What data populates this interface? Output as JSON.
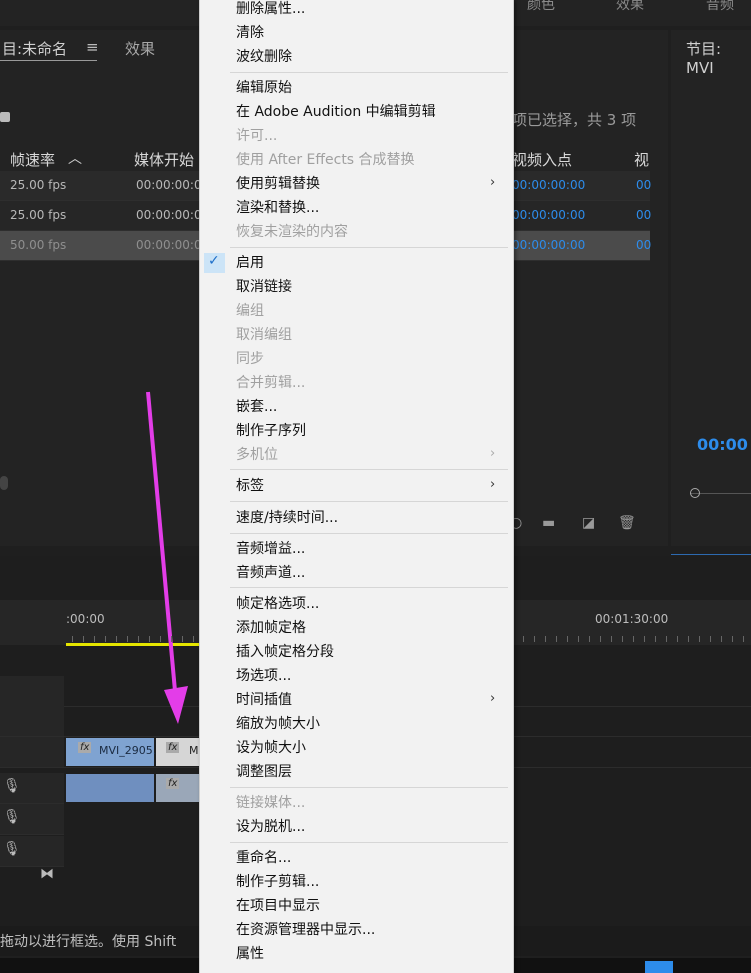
{
  "top_tabs": [
    "颜色",
    "效果",
    "音频"
  ],
  "project_panel": {
    "tab_label": "目:未命名",
    "effects_tab": "效果",
    "selection_info": "项已选择，共 3 项",
    "columns": [
      "帧速率",
      "媒体开始",
      "视频入点",
      "视"
    ],
    "rows": [
      {
        "fps": "25.00 fps",
        "media_start": "00:00:00:0",
        "video_in": "00:00:00:00",
        "extra": "00"
      },
      {
        "fps": "25.00 fps",
        "media_start": "00:00:00:0",
        "video_in": "00:00:00:00",
        "extra": "00"
      },
      {
        "fps": "50.00 fps",
        "media_start": "00:00:00:0",
        "video_in": "00:00:00:00",
        "extra": "00"
      }
    ]
  },
  "program_panel": {
    "tab_label": "节目: MVI",
    "timecode": "00:00"
  },
  "timeline": {
    "time_start": ":00:00",
    "time_mark": "00:01:30:00",
    "clip_video_1": "MVI_2905.",
    "clip_video_2": "M",
    "fx_label": "fx"
  },
  "status_bar": "拖动以进行框选。使用 Shift",
  "context_menu": {
    "items": [
      {
        "label": "删除属性...",
        "disabled": false
      },
      {
        "label": "清除",
        "disabled": false
      },
      {
        "label": "波纹删除",
        "disabled": false
      },
      {
        "label": "编辑原始",
        "disabled": false
      },
      {
        "label": "在 Adobe Audition 中编辑剪辑",
        "disabled": false
      },
      {
        "label": "许可...",
        "disabled": true
      },
      {
        "label": "使用 After Effects 合成替换",
        "disabled": true
      },
      {
        "label": "使用剪辑替换",
        "disabled": false,
        "submenu": true
      },
      {
        "label": "渲染和替换...",
        "disabled": false
      },
      {
        "label": "恢复未渲染的内容",
        "disabled": true
      },
      {
        "label": "启用",
        "disabled": false,
        "checked": true
      },
      {
        "label": "取消链接",
        "disabled": false
      },
      {
        "label": "编组",
        "disabled": true
      },
      {
        "label": "取消编组",
        "disabled": true
      },
      {
        "label": "同步",
        "disabled": true
      },
      {
        "label": "合并剪辑...",
        "disabled": true
      },
      {
        "label": "嵌套...",
        "disabled": false
      },
      {
        "label": "制作子序列",
        "disabled": false
      },
      {
        "label": "多机位",
        "disabled": true,
        "submenu": true
      },
      {
        "label": "标签",
        "disabled": false,
        "submenu": true
      },
      {
        "label": "速度/持续时间...",
        "disabled": false
      },
      {
        "label": "音频增益...",
        "disabled": false
      },
      {
        "label": "音频声道...",
        "disabled": false
      },
      {
        "label": "帧定格选项...",
        "disabled": false
      },
      {
        "label": "添加帧定格",
        "disabled": false
      },
      {
        "label": "插入帧定格分段",
        "disabled": false
      },
      {
        "label": "场选项...",
        "disabled": false
      },
      {
        "label": "时间插值",
        "disabled": false,
        "submenu": true
      },
      {
        "label": "缩放为帧大小",
        "disabled": false
      },
      {
        "label": "设为帧大小",
        "disabled": false
      },
      {
        "label": "调整图层",
        "disabled": false
      },
      {
        "label": "链接媒体...",
        "disabled": true
      },
      {
        "label": "设为脱机...",
        "disabled": false
      },
      {
        "label": "重命名...",
        "disabled": false
      },
      {
        "label": "制作子剪辑...",
        "disabled": false
      },
      {
        "label": "在项目中显示",
        "disabled": false
      },
      {
        "label": "在资源管理器中显示...",
        "disabled": false
      },
      {
        "label": "属性",
        "disabled": false
      }
    ]
  },
  "colors": {
    "accent_blue": "#2d8ceb",
    "arrow_magenta": "#e33de8",
    "playhead_yellow": "#e6e600",
    "clip_blue": "#7fa3d1"
  }
}
